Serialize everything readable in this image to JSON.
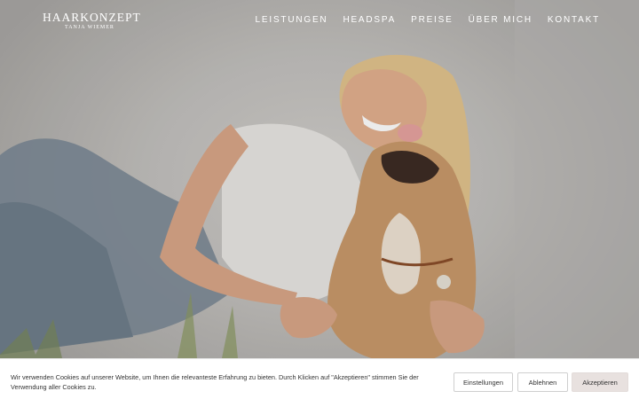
{
  "brand": {
    "name": "HAARKONZEPT",
    "subtitle": "TANJA WIEMER"
  },
  "nav": {
    "items": [
      "LEISTUNGEN",
      "HEADSPA",
      "PREISE",
      "ÜBER MICH",
      "KONTAKT"
    ]
  },
  "hero": {
    "image_description_icon": "hero-photo"
  },
  "cookie": {
    "text": "Wir verwenden Cookies auf unserer Website, um Ihnen die relevanteste Erfahrung zu bieten. Durch Klicken auf \"Akzeptieren\" stimmen Sie der Verwendung aller Cookies zu.",
    "settings_label": "Einstellungen",
    "reject_label": "Ablehnen",
    "accept_label": "Akzeptieren"
  },
  "colors": {
    "accept_button": "#e8e1df",
    "nav_text": "#ffffff"
  }
}
